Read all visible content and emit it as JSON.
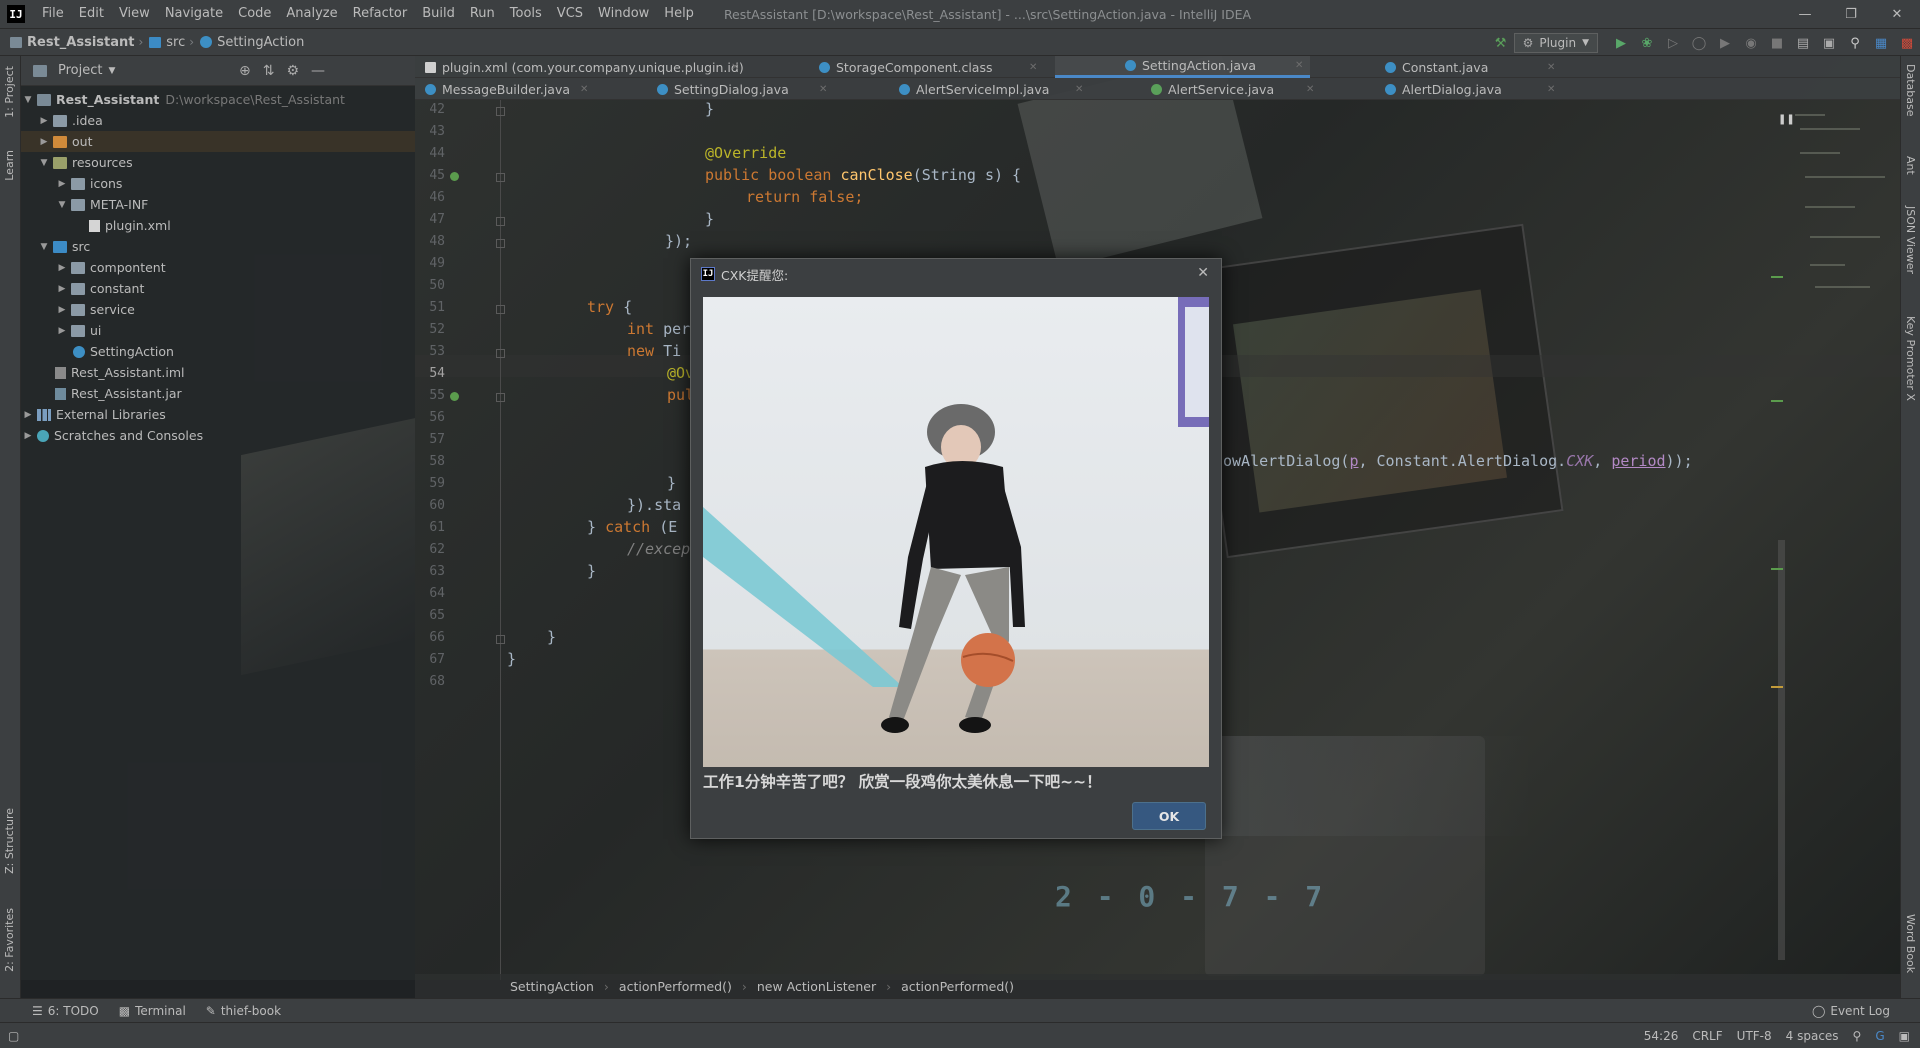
{
  "titlebar": {
    "menu": [
      "File",
      "Edit",
      "View",
      "Navigate",
      "Code",
      "Analyze",
      "Refactor",
      "Build",
      "Run",
      "Tools",
      "VCS",
      "Window",
      "Help"
    ],
    "window_title": "RestAssistant [D:\\workspace\\Rest_Assistant] - ...\\src\\SettingAction.java - IntelliJ IDEA"
  },
  "navbar": {
    "project": "Rest_Assistant",
    "folder": "src",
    "file": "SettingAction",
    "run_config": "Plugin"
  },
  "left_stripe": [
    "1: Project",
    "Learn",
    "Z: Structure",
    "2: Favorites"
  ],
  "right_stripe": [
    "Database",
    "Ant",
    "JSON Viewer",
    "Key Promoter X",
    "Word Book"
  ],
  "project_panel": {
    "title": "Project",
    "tree": [
      {
        "label": "Rest_Assistant",
        "path": "D:\\workspace\\Rest_Assistant",
        "icon": "folder-module-icon"
      },
      {
        "label": ".idea",
        "icon": "folder-icon"
      },
      {
        "label": "out",
        "icon": "folder-excluded-icon"
      },
      {
        "label": "resources",
        "icon": "folder-resources-icon"
      },
      {
        "label": "icons",
        "icon": "folder-icon"
      },
      {
        "label": "META-INF",
        "icon": "folder-icon"
      },
      {
        "label": "plugin.xml",
        "icon": "xml-file-icon"
      },
      {
        "label": "src",
        "icon": "folder-source-icon"
      },
      {
        "label": "compontent",
        "icon": "folder-icon"
      },
      {
        "label": "constant",
        "icon": "folder-icon"
      },
      {
        "label": "service",
        "icon": "folder-icon"
      },
      {
        "label": "ui",
        "icon": "folder-icon"
      },
      {
        "label": "SettingAction",
        "icon": "class-icon"
      },
      {
        "label": "Rest_Assistant.iml",
        "icon": "iml-file-icon"
      },
      {
        "label": "Rest_Assistant.jar",
        "icon": "jar-file-icon"
      },
      {
        "label": "External Libraries",
        "icon": "library-icon"
      },
      {
        "label": "Scratches and Consoles",
        "icon": "scratches-icon"
      }
    ]
  },
  "tabs_row1": [
    "plugin.xml (com.your.company.unique.plugin.id)",
    "StorageComponent.class",
    "SettingAction.java",
    "Constant.java"
  ],
  "tabs_row2": [
    "MessageBuilder.java",
    "SettingDialog.java",
    "AlertServiceImpl.java",
    "AlertService.java",
    "AlertDialog.java"
  ],
  "editor": {
    "line_numbers": [
      "42",
      "43",
      "44",
      "45",
      "46",
      "47",
      "48",
      "49",
      "50",
      "51",
      "52",
      "53",
      "54",
      "55",
      "56",
      "57",
      "58",
      "59",
      "60",
      "61",
      "62",
      "63",
      "64",
      "65",
      "66",
      "67",
      "68"
    ],
    "current_line": "54",
    "code": {
      "l42": "}",
      "l44_ann": "@Override",
      "l45_kw": "public boolean ",
      "l45_fn": "canClose",
      "l45_rest": "(String s) {",
      "l46_kw": "return false",
      "l46_rest": ";",
      "l47": "}",
      "l48": "});",
      "l51_kw": "try",
      "l51_rest": " {",
      "l52_kw": "int",
      "l52_rest": " per",
      "l53_kw": "new",
      "l53_rest": " Ti",
      "l54_ann": "@Ov",
      "l55_kw": "pul",
      "l59_left": "}",
      "l59_right_pre": "owAlertDialog(",
      "l59_p": "p",
      "l59_mid": ", Constant.AlertDialog.",
      "l59_const": "CXK",
      "l59_sep": ", ",
      "l59_period": "period",
      "l59_end": "));",
      "l60": "}).sta",
      "l61_pre": "} ",
      "l61_kw": "catch",
      "l61_rest": " (E",
      "l62_cm": "//excep",
      "l63": "}",
      "l66": "}",
      "l67": "}"
    }
  },
  "breadcrumbs": [
    "SettingAction",
    "actionPerformed()",
    "new ActionListener",
    "actionPerformed()"
  ],
  "bottom_tools": {
    "todo": "6: TODO",
    "terminal": "Terminal",
    "thief": "thief-book",
    "event_log": "Event Log"
  },
  "status": {
    "position": "54:26",
    "line_sep": "CRLF",
    "encoding": "UTF-8",
    "indent": "4 spaces"
  },
  "dialog": {
    "title": "CXK提醒您:",
    "message": "工作1分钟辛苦了吧？  欣赏一段鸡你太美休息一下吧~~！",
    "ok": "OK"
  },
  "background_art": {
    "text": "2 - 0 - 7 - 7"
  },
  "colors": {
    "accent": "#4a88c7",
    "keyword": "#cc7832",
    "annotation": "#bbb529",
    "function": "#ffc66d",
    "ok_button": "#365880"
  }
}
